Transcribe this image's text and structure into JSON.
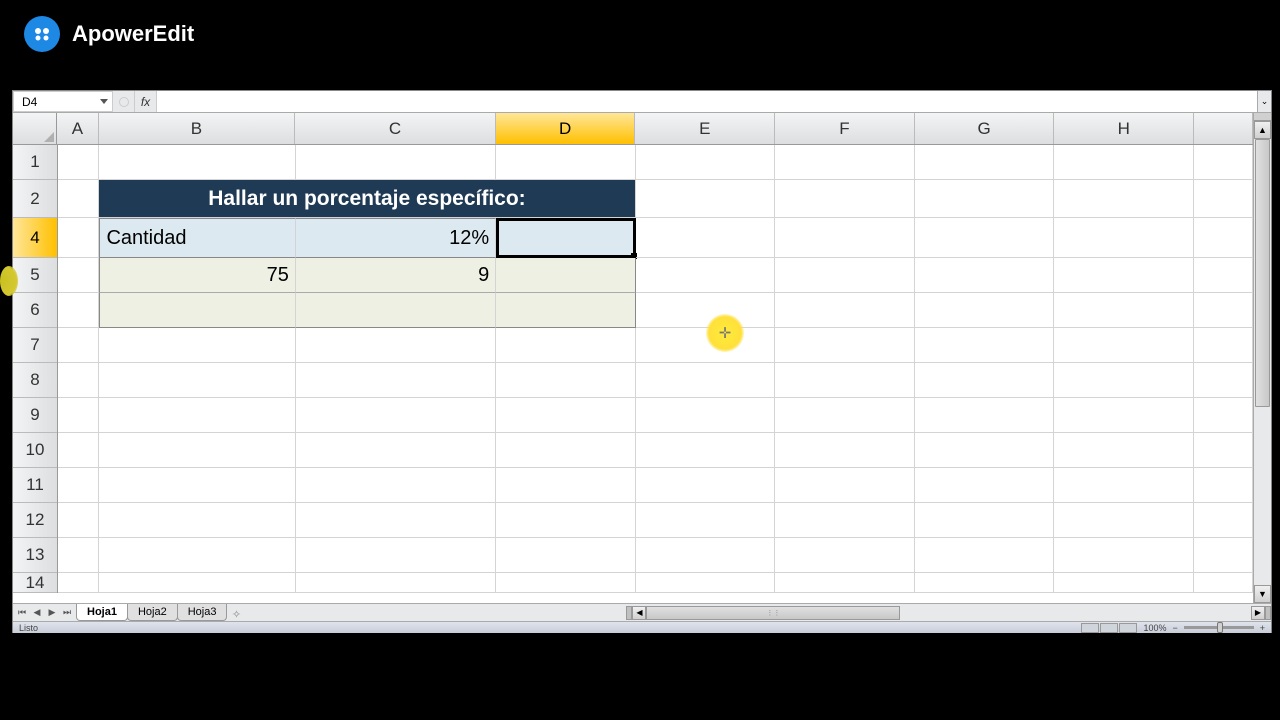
{
  "watermark": {
    "text": "ApowerEdit"
  },
  "name_box": {
    "value": "D4"
  },
  "formula": {
    "value": ""
  },
  "columns": [
    "A",
    "B",
    "C",
    "D",
    "E",
    "F",
    "G",
    "H"
  ],
  "selected_column": "D",
  "visible_rows": [
    "1",
    "2",
    "4",
    "5",
    "6",
    "7",
    "8",
    "9",
    "10",
    "11",
    "12",
    "13",
    "14"
  ],
  "selected_row": "4",
  "cells": {
    "title": "Hallar un porcentaje específico:",
    "b4": "Cantidad",
    "c4": "12%",
    "b5": "75",
    "c5": "9"
  },
  "sheets": {
    "active": "Hoja1",
    "tabs": [
      "Hoja1",
      "Hoja2",
      "Hoja3"
    ]
  },
  "status": {
    "left": "Listo",
    "zoom": "100%"
  },
  "icons": {
    "fx": "fx",
    "cursor": "✛"
  }
}
